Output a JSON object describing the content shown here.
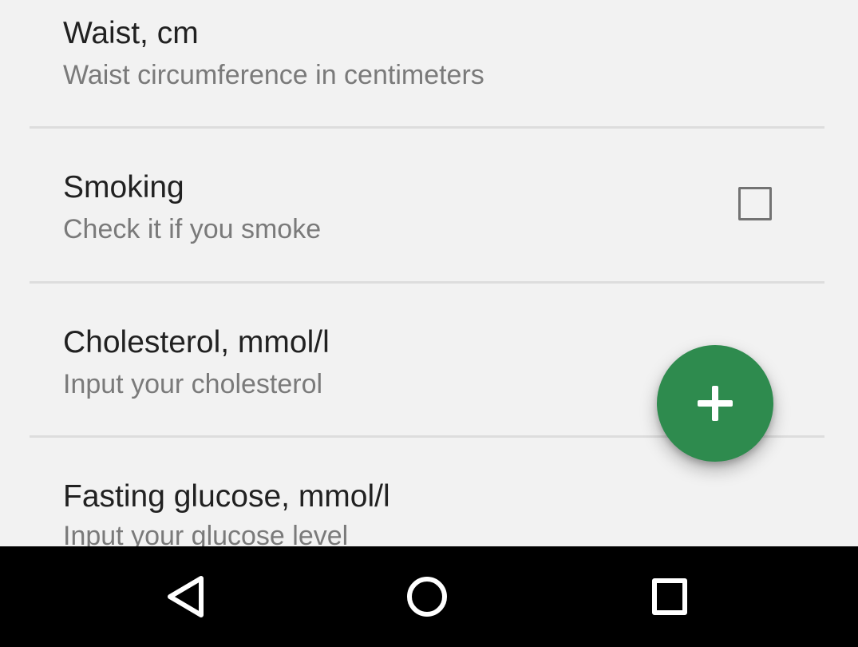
{
  "preferences": [
    {
      "title": "Waist, cm",
      "summary": "Waist circumference in centimeters"
    },
    {
      "title": "Smoking",
      "summary": "Check it if you smoke",
      "checked": false
    },
    {
      "title": "Cholesterol, mmol/l",
      "summary": "Input your cholesterol"
    },
    {
      "title": "Fasting glucose, mmol/l",
      "summary": "Input your glucose level"
    }
  ],
  "fab": {
    "icon": "plus-icon",
    "color": "#2e8b4e"
  },
  "navbar": {
    "back_icon": "back-triangle-icon",
    "home_icon": "home-circle-icon",
    "recents_icon": "recents-square-icon"
  }
}
